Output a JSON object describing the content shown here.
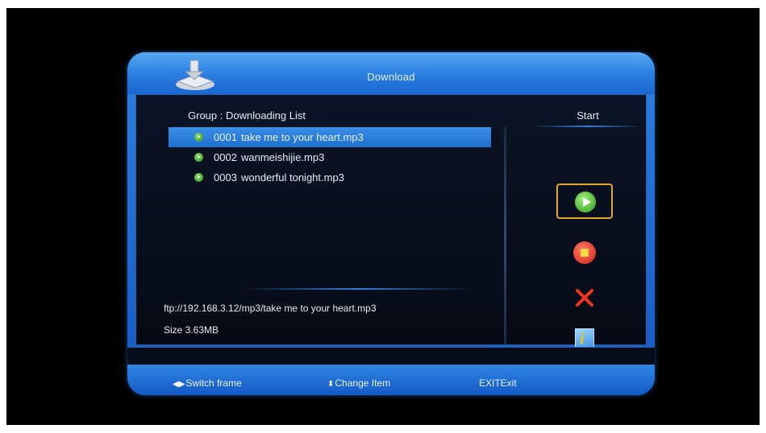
{
  "window": {
    "title": "Download"
  },
  "list": {
    "group_label": "Group : Downloading List",
    "items": [
      {
        "num": "0001",
        "name": "take me to your heart.mp3",
        "selected": true
      },
      {
        "num": "0002",
        "name": "wanmeishijie.mp3",
        "selected": false
      },
      {
        "num": "0003",
        "name": "wonderful tonight.mp3",
        "selected": false
      }
    ]
  },
  "details": {
    "path": "ftp://192.168.3.12/mp3/take me to your heart.mp3",
    "size": "Size 3.63MB"
  },
  "actions": {
    "title": "Start",
    "buttons": [
      {
        "icon": "play-icon",
        "focused": true
      },
      {
        "icon": "stop-icon"
      },
      {
        "icon": "delete-icon"
      },
      {
        "icon": "info-icon"
      }
    ]
  },
  "footer": {
    "switch_frame": "Switch frame",
    "change_item": "Change Item",
    "exit_key": "EXIT",
    "exit_label": "Exit"
  },
  "colors": {
    "accent": "#1e6fcf",
    "focus_border": "#e0a92a"
  }
}
